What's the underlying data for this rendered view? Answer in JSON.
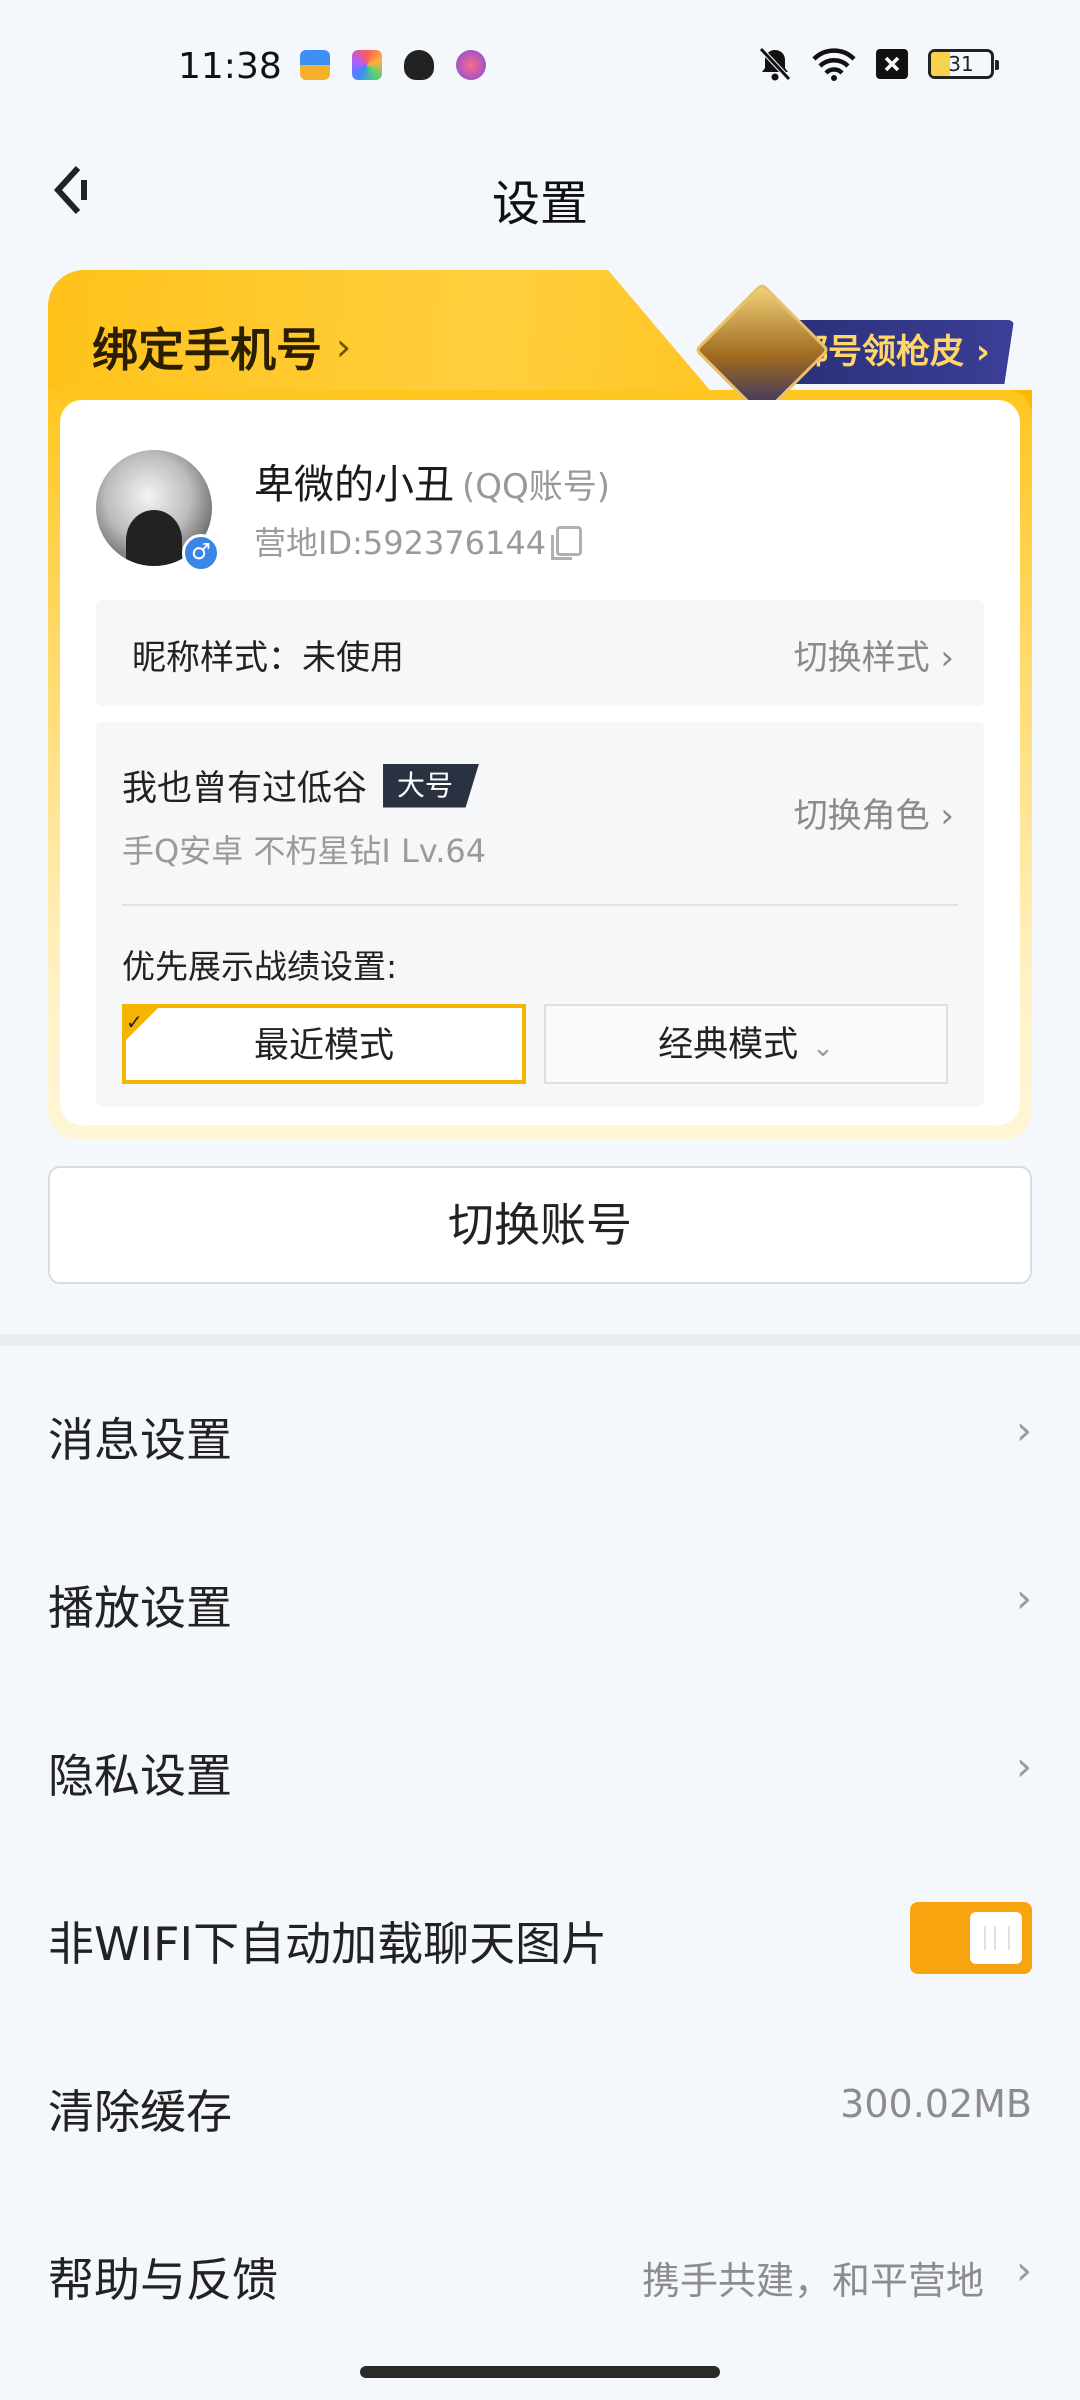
{
  "status_bar": {
    "time": "11:38",
    "battery": "31",
    "notification_icons": [
      "wallet-app-icon",
      "photos-app-icon",
      "shield-app-icon",
      "game-app-icon"
    ],
    "right_icons": [
      "bell-off-icon",
      "wifi-icon",
      "close-box-icon",
      "battery-icon"
    ]
  },
  "header": {
    "title": "设置",
    "back_icon": "back-arrow-icon"
  },
  "profile_card": {
    "bind_phone_label": "绑定手机号",
    "bind_phone_chevron": "›",
    "skin_reward_label": "绑号领枪皮 ›",
    "nickname": "卑微的小丑",
    "account_type": "(QQ账号)",
    "camp_id": "营地ID:592376144",
    "gender_symbol": "♂",
    "nickname_style_label": "昵称样式：未使用",
    "switch_style_label": "切换样式 ›",
    "role_name": "我也曾有过低谷",
    "role_tag": "大号",
    "role_detail": "手Q安卓  不朽星钻I  Lv.64",
    "switch_role_label": "切换角色 ›",
    "preferred_label": "优先展示战绩设置:",
    "mode_recent": "最近模式",
    "mode_classic": "经典模式",
    "mode_classic_arrow": "⌄",
    "selected_mode": "最近模式"
  },
  "switch_account_label": "切换账号",
  "settings": {
    "message": {
      "label": "消息设置",
      "chevron": "›"
    },
    "playback": {
      "label": "播放设置",
      "chevron": "›"
    },
    "privacy": {
      "label": "隐私设置",
      "chevron": "›"
    },
    "auto_load": {
      "label": "非WIFI下自动加载聊天图片",
      "enabled": true
    },
    "clear_cache": {
      "label": "清除缓存",
      "value": "300.02MB"
    },
    "help": {
      "label": "帮助与反馈",
      "value": "携手共建，和平营地",
      "chevron": "›"
    }
  },
  "colors": {
    "accent": "#f7a40e",
    "card_gold": "#ffc21a",
    "background": "#f4f8fc",
    "badge_blue": "#3a86e8"
  }
}
